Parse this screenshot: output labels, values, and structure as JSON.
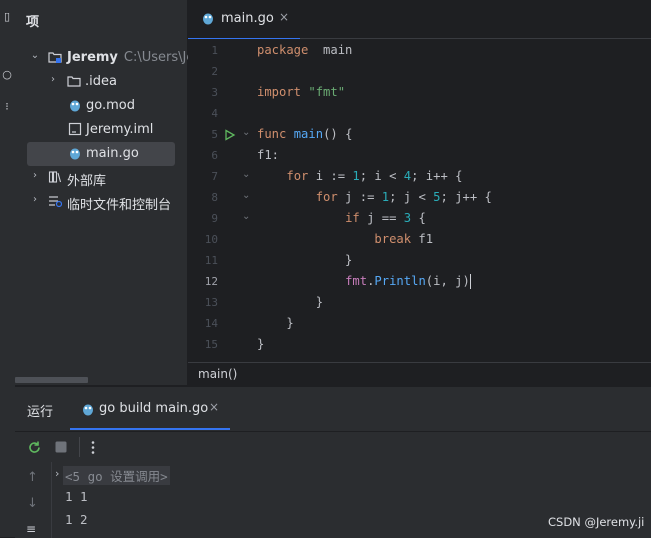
{
  "project": {
    "title": "项",
    "tree": [
      {
        "label": "Jeremy",
        "path": "C:\\Users\\Jer",
        "icon": "folder-module-icon"
      },
      {
        "label": ".idea",
        "icon": "folder-icon"
      },
      {
        "label": "go.mod",
        "icon": "gopher-file-icon"
      },
      {
        "label": "Jeremy.iml",
        "icon": "iml-file-icon"
      },
      {
        "label": "main.go",
        "icon": "gopher-file-icon"
      },
      {
        "label": "外部库",
        "icon": "library-icon"
      },
      {
        "label": "临时文件和控制台",
        "icon": "scratches-icon"
      }
    ]
  },
  "editor": {
    "tab": {
      "label": "main.go",
      "close": "×"
    },
    "line_numbers": [
      "1",
      "2",
      "3",
      "4",
      "5",
      "6",
      "7",
      "8",
      "9",
      "10",
      "11",
      "12",
      "13",
      "14",
      "15"
    ],
    "lines": [
      {
        "t": [
          [
            "kw",
            "package"
          ],
          [
            "",
            "  main"
          ]
        ]
      },
      {
        "t": []
      },
      {
        "t": [
          [
            "kw",
            "import"
          ],
          [
            "",
            " "
          ],
          [
            "str",
            "\"fmt\""
          ]
        ]
      },
      {
        "t": []
      },
      {
        "t": [
          [
            "kw",
            "func"
          ],
          [
            "",
            " "
          ],
          [
            "fn",
            "main"
          ],
          [
            "",
            "() {"
          ]
        ]
      },
      {
        "t": [
          [
            "",
            "f1:"
          ]
        ]
      },
      {
        "t": [
          [
            "",
            "    "
          ],
          [
            "kw",
            "for"
          ],
          [
            "",
            " i := "
          ],
          [
            "num",
            "1"
          ],
          [
            "",
            "; i < "
          ],
          [
            "num",
            "4"
          ],
          [
            "",
            "; i++ {"
          ]
        ]
      },
      {
        "t": [
          [
            "",
            "        "
          ],
          [
            "kw",
            "for"
          ],
          [
            "",
            " j := "
          ],
          [
            "num",
            "1"
          ],
          [
            "",
            "; j < "
          ],
          [
            "num",
            "5"
          ],
          [
            "",
            "; j++ {"
          ]
        ]
      },
      {
        "t": [
          [
            "",
            "            "
          ],
          [
            "kw",
            "if"
          ],
          [
            "",
            " j == "
          ],
          [
            "num",
            "3"
          ],
          [
            "",
            " {"
          ]
        ]
      },
      {
        "t": [
          [
            "",
            "                "
          ],
          [
            "kw",
            "break"
          ],
          [
            "",
            " f1"
          ]
        ]
      },
      {
        "t": [
          [
            "",
            "            }"
          ]
        ]
      },
      {
        "t": [
          [
            "",
            "            "
          ],
          [
            "pkg",
            "fmt"
          ],
          [
            "",
            "."
          ],
          [
            "mth",
            "Println"
          ],
          [
            "",
            "(i, j)"
          ]
        ]
      },
      {
        "t": [
          [
            "",
            "        }"
          ]
        ]
      },
      {
        "t": [
          [
            "",
            "    }"
          ]
        ]
      },
      {
        "t": [
          [
            "",
            "}"
          ]
        ]
      }
    ],
    "breadcrumb": "main()"
  },
  "run": {
    "title": "运行",
    "tab": {
      "label": "go build main.go",
      "close": "×"
    },
    "console_header": "<5 go 设置调用>",
    "output": [
      "1 1",
      "1 2"
    ],
    "watermark": "CSDN @Jeremy.ji"
  }
}
